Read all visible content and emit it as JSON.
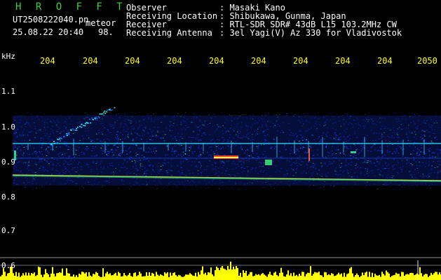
{
  "brand": "H R O F F T",
  "file_name": "UT2508222040.pn",
  "tag": "meteor",
  "datetime": "25.08.22 20:40",
  "count": "98.",
  "fields": [
    {
      "label": "Observer",
      "value": ": Masaki Kano"
    },
    {
      "label": "Receiving Location",
      "value": ": Shibukawa, Gunma, Japan"
    },
    {
      "label": "Receiver",
      "value": ": RTL-SDR SDR# 43dB L15 103.2MHz CW"
    },
    {
      "label": "Receiving Antenna",
      "value": ": 3el Yagi(V) Az 330 for Vladivostok"
    }
  ],
  "yaxis": {
    "unit": "kHz",
    "labels": [
      "1.1",
      "1.0",
      "0.9",
      "0.8",
      "0.7",
      "0.6"
    ]
  },
  "xaxis": {
    "labels": [
      "204",
      "204",
      "204",
      "204",
      "204",
      "204",
      "204",
      "204",
      "204",
      "2050"
    ]
  },
  "colors": {
    "background": "#000000",
    "tick_labels": "#ffff00",
    "brand": "#3ecf3e",
    "bars": "#ffff00"
  }
}
